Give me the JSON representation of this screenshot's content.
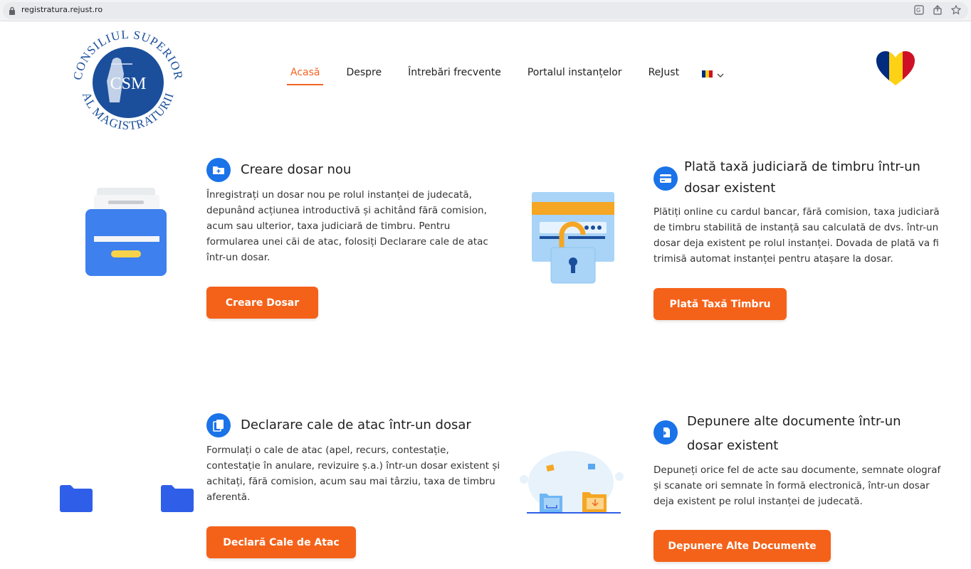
{
  "browser": {
    "url": "registratura.rejust.ro"
  },
  "logo": {
    "text_top": "CONSILIUL SUPERIOR",
    "text_bottom": "AL MAGISTRATURII",
    "initials": "CSM"
  },
  "nav": {
    "items": [
      {
        "label": "Acasă",
        "active": true
      },
      {
        "label": "Despre",
        "active": false
      },
      {
        "label": "Întrebări frecvente",
        "active": false
      },
      {
        "label": "Portalul instanțelor",
        "active": false
      },
      {
        "label": "ReJust",
        "active": false
      }
    ],
    "language_icon": "romania-flag-icon"
  },
  "cards": {
    "create": {
      "title": "Creare dosar nou",
      "lines": [
        "Înregistrați un dosar nou pe rolul instanței de judecată,",
        "depunând acțiunea introductivă și achitând fără comision,",
        "acum sau ulterior, taxa judiciară de timbru. Pentru",
        "formularea unei căi de atac, folosiți Declarare cale de atac",
        "într-un dosar."
      ],
      "button": "Creare Dosar"
    },
    "fee": {
      "title_lines": [
        "Plată taxă judiciară de timbru într-un",
        "dosar existent"
      ],
      "lines": [
        "Plătiți online cu cardul bancar, fără comision, taxa judiciară",
        "de timbru stabilită de instanță sau calculată de dvs. într-un",
        "dosar deja existent pe rolul instanței. Dovada de plată va fi",
        "trimisă automat instanței pentru atașare la dosar."
      ],
      "button": "Plată Taxă Timbru"
    },
    "appeal": {
      "title": "Declarare cale de atac într-un dosar",
      "lines": [
        "Formulați o cale de atac (apel, recurs, contestație,",
        "contestație în anulare, revizuire ș.a.) într-un dosar existent și",
        "achitați, fără comision, acum sau mai târziu, taxa de timbru",
        "aferentă."
      ],
      "button": "Declară Cale de Atac"
    },
    "documents": {
      "title_lines": [
        "Depunere alte documente într-un",
        "dosar existent"
      ],
      "lines": [
        "Depuneți orice fel de acte sau documente, semnate olograf",
        "și scanate ori semnate în formă electronică, într-un dosar",
        "deja existent pe rolul instanței de judecată."
      ],
      "button": "Depunere Alte Documente"
    }
  },
  "colors": {
    "accent": "#f26522",
    "button": "#f4621a",
    "icon_blue": "#1a73e8"
  }
}
